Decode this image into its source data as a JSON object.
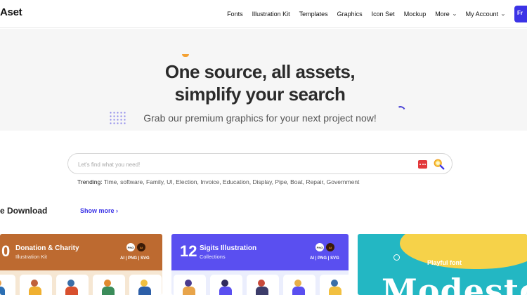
{
  "brand": {
    "logo": "Aset"
  },
  "nav": {
    "items": [
      "Fonts",
      "Illustration Kit",
      "Templates",
      "Graphics",
      "Icon Set",
      "Mockup"
    ],
    "more": "More",
    "account": "My Account",
    "cta": "Fr"
  },
  "hero": {
    "title_line1": "One source, all assets,",
    "title_line2": "simplify your search",
    "subtitle": "Grab our premium graphics for your next project now!"
  },
  "search": {
    "placeholder": "Let's find what you need!",
    "value": "",
    "trending_label": "Trending:",
    "trending_terms": "Time, software, Family, UI, Election, Invoice, Education, Display, Pipe, Boat, Repair, Government"
  },
  "section": {
    "title": "e Download",
    "show_more": "Show more ›"
  },
  "cards": [
    {
      "number": "0",
      "title": "Donation & Charity",
      "subtitle": "Illustration Kit",
      "badges": [
        "PNG",
        "Ai"
      ],
      "formats": "AI | PNG | SVG"
    },
    {
      "number": "12",
      "title": "Sigits Illustration",
      "subtitle": "Collections",
      "badges": [
        "PNG",
        "Ai"
      ],
      "formats": "AI | PNG | SVG"
    },
    {
      "tag": "Playful font",
      "sample": "Modesto"
    }
  ],
  "colors": {
    "accent": "#3b33e6",
    "card1_band": "#bd6a30",
    "card2_band": "#5a4ff0",
    "card3_bg": "#23b7c3"
  },
  "icons": [
    "chevron-down-icon",
    "more-dots-icon",
    "search-icon"
  ]
}
